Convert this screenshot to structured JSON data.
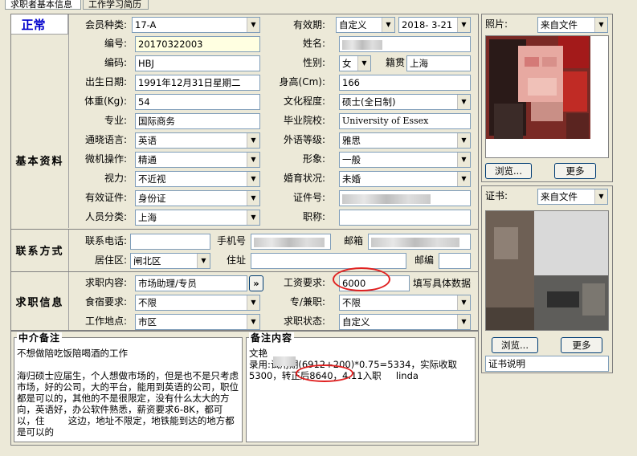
{
  "tabs": [
    {
      "label": "求职者基本信息"
    },
    {
      "label": "工作学习简历"
    }
  ],
  "status": "正常",
  "sections": {
    "basic": "基本资料",
    "contact": "联系方式",
    "job": "求职信息"
  },
  "basic": {
    "member_type": {
      "label": "会员种类:",
      "value": "17-A"
    },
    "validity": {
      "label": "有效期:",
      "value": "自定义",
      "date": "2018- 3-21"
    },
    "number": {
      "label": "编号:",
      "value": "20170322003"
    },
    "name": {
      "label": "姓名:"
    },
    "code": {
      "label": "编码:",
      "value": "HBJ"
    },
    "gender": {
      "label": "性别:",
      "value": "女"
    },
    "native": {
      "label": "籍贯",
      "value": "上海"
    },
    "birth": {
      "label": "出生日期:",
      "value": "1991年12月31日星期二"
    },
    "height": {
      "label": "身高(Cm):",
      "value": "166"
    },
    "weight": {
      "label": "体重(Kg):",
      "value": "54"
    },
    "education": {
      "label": "文化程度:",
      "value": "硕士(全日制)"
    },
    "major": {
      "label": "专业:",
      "value": "国际商务"
    },
    "school": {
      "label": "毕业院校:",
      "value": "University of Essex"
    },
    "language": {
      "label": "通晓语言:",
      "value": "英语"
    },
    "lang_level": {
      "label": "外语等级:",
      "value": "雅思"
    },
    "computer": {
      "label": "微机操作:",
      "value": "精通"
    },
    "appearance": {
      "label": "形象:",
      "value": "一般"
    },
    "vision": {
      "label": "视力:",
      "value": "不近视"
    },
    "marital": {
      "label": "婚育状况:",
      "value": "未婚"
    },
    "id_type": {
      "label": "有效证件:",
      "value": "身份证"
    },
    "id_no": {
      "label": "证件号:"
    },
    "category": {
      "label": "人员分类:",
      "value": "上海"
    },
    "title": {
      "label": "职称:",
      "value": ""
    }
  },
  "photo": {
    "label": "照片:",
    "source": "来自文件",
    "browse": "浏览...",
    "more": "更多"
  },
  "cert": {
    "label": "证书:",
    "source": "来自文件",
    "browse": "浏览...",
    "more": "更多",
    "desc": "证书说明"
  },
  "contact": {
    "phone": {
      "label": "联系电话:",
      "value": ""
    },
    "mobile": {
      "label": "手机号"
    },
    "email": {
      "label": "邮箱"
    },
    "district": {
      "label": "居住区:",
      "value": "闸北区"
    },
    "address": {
      "label": "住址",
      "value": ""
    },
    "zip": {
      "label": "邮编",
      "value": ""
    }
  },
  "job": {
    "content": {
      "label": "求职内容:",
      "value": "市场助理/专员"
    },
    "salary": {
      "label": "工资要求:",
      "value": "6000",
      "hint": "填写具体数据"
    },
    "lodging": {
      "label": "食宿要求:",
      "value": "不限"
    },
    "fulltime": {
      "label": "专/兼职:",
      "value": "不限"
    },
    "location": {
      "label": "工作地点:",
      "value": "市区"
    },
    "job_status": {
      "label": "求职状态:",
      "value": "自定义"
    },
    "more_btn": "»"
  },
  "agent_note": {
    "title": "中介备注",
    "text": "不想做陪吃饭陪喝酒的工作\n\n海归硕士应届生，个人想做市场的，但是也不是只考虑市场，好的公司，大的平台，能用到英语的公司，职位都是可以的，其他的不是很限定，没有什么太大的方向，英语好，办公软件熟悉，薪资要求6-8K，都可以，住        这边，地址不限定，地铁能到达的地方都是可以的"
  },
  "remark": {
    "title": "备注内容",
    "line1": "文艳",
    "line2": "录用:试用期(6912+200)*0.75=5334，实际收取5300，转正后8640，4.11入职     linda"
  },
  "colors": {
    "status_blue": "#0000cc",
    "ring_red": "#e02020",
    "yellow_field": "#ffffe1"
  }
}
